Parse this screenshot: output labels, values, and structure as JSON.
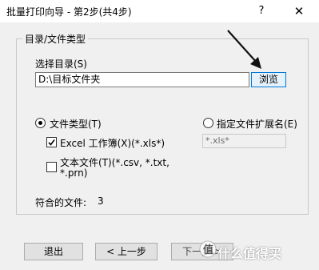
{
  "window": {
    "title": "批量打印向导 - 第2步(共4步)",
    "help_label": "?",
    "close_label": "✕"
  },
  "group": {
    "legend": "目录/文件类型",
    "select_dir_label": "选择目录(S)",
    "dir_value": "D:\\目标文件夹",
    "browse_label": "浏览"
  },
  "options": {
    "file_type_label": "文件类型(T)",
    "file_type_selected": true,
    "custom_ext_label": "指定文件扩展名(E)",
    "custom_ext_selected": false,
    "custom_ext_value": "*.xls*",
    "excel_label": "Excel 工作簿(X)(*.xls*)",
    "excel_checked": true,
    "text_label_line1": "文本文件(T)(*.csv, *.txt,",
    "text_label_line2": "*.prn)",
    "text_checked": false
  },
  "status": {
    "matching_files_label": "符合的文件:",
    "matching_files_count": "3"
  },
  "buttons": {
    "exit": "退出",
    "prev": "< 上一步",
    "next": "下一步 >"
  },
  "watermark": {
    "text": "什么值得买"
  }
}
